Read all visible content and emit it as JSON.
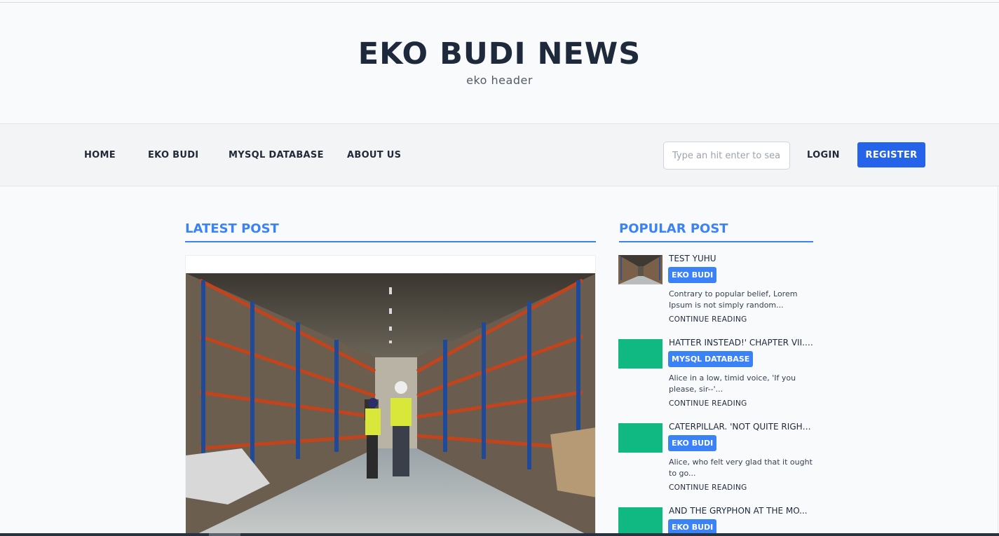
{
  "site": {
    "title": "EKO BUDI NEWS",
    "subtitle": "eko header"
  },
  "nav": {
    "items": [
      {
        "label": "HOME"
      },
      {
        "label": "EKO BUDI"
      },
      {
        "label": "MYSQL DATABASE"
      },
      {
        "label": "ABOUT US"
      }
    ],
    "search_placeholder": "Type an hit enter to search",
    "login_label": "LOGIN",
    "register_label": "REGISTER"
  },
  "latest": {
    "heading": "LATEST POST"
  },
  "popular": {
    "heading": "POPULAR POST",
    "items": [
      {
        "title": "TEST YUHU",
        "category": "EKO BUDI",
        "excerpt": "Contrary to popular belief, Lorem Ipsum is not simply random...",
        "more": "CONTINUE READING",
        "thumb": "warehouse-photo"
      },
      {
        "title": "HATTER INSTEAD!' CHAPTER VII. ...",
        "category": "MYSQL DATABASE",
        "excerpt": "Alice in a low, timid voice, 'If you please, sir--'...",
        "more": "CONTINUE READING",
        "thumb": "green-placeholder"
      },
      {
        "title": "CATERPILLAR. 'NOT QUITE RIGHT...",
        "category": "EKO BUDI",
        "excerpt": "Alice, who felt very glad that it ought to go...",
        "more": "CONTINUE READING",
        "thumb": "green-placeholder"
      },
      {
        "title": "AND THE GRYPHON AT THE MO...",
        "category": "EKO BUDI",
        "excerpt": "",
        "more": "",
        "thumb": "green-placeholder"
      }
    ]
  },
  "colors": {
    "accent": "#3b82f6",
    "register": "#2563eb",
    "placeholder_thumb": "#10b981"
  }
}
